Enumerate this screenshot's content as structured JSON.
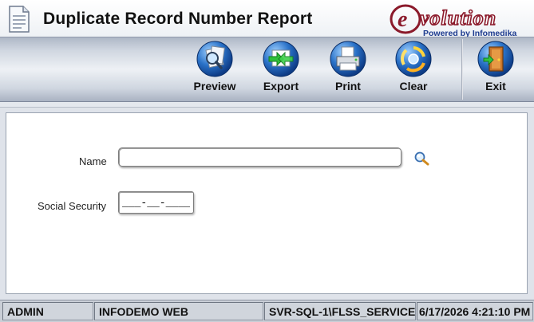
{
  "window": {
    "title": "Duplicate Record Number Report",
    "logo_text": "Evolution",
    "logo_tagline": "Powered by Infomedika"
  },
  "toolbar": {
    "buttons": [
      {
        "label": "Preview",
        "icon": "preview-magnifier-icon"
      },
      {
        "label": "Export",
        "icon": "export-arrows-icon"
      },
      {
        "label": "Print",
        "icon": "printer-icon"
      },
      {
        "label": "Clear",
        "icon": "clear-recycle-icon"
      },
      {
        "label": "Exit",
        "icon": "exit-door-icon"
      }
    ]
  },
  "form": {
    "name_label": "Name",
    "name_value": "",
    "ssn_label": "Social Security",
    "ssn_value": "___-__-____"
  },
  "status": {
    "user": "ADMIN",
    "company": "INFODEMO WEB",
    "server": "SVR-SQL-1\\FLSS_SERVICE",
    "datetime": "6/17/2026 4:21:10 PM"
  },
  "colors": {
    "toolbar_icon_blue": "#1f5fb8",
    "logo_red": "#8b1a2b",
    "logo_blue": "#1d3b8f"
  }
}
